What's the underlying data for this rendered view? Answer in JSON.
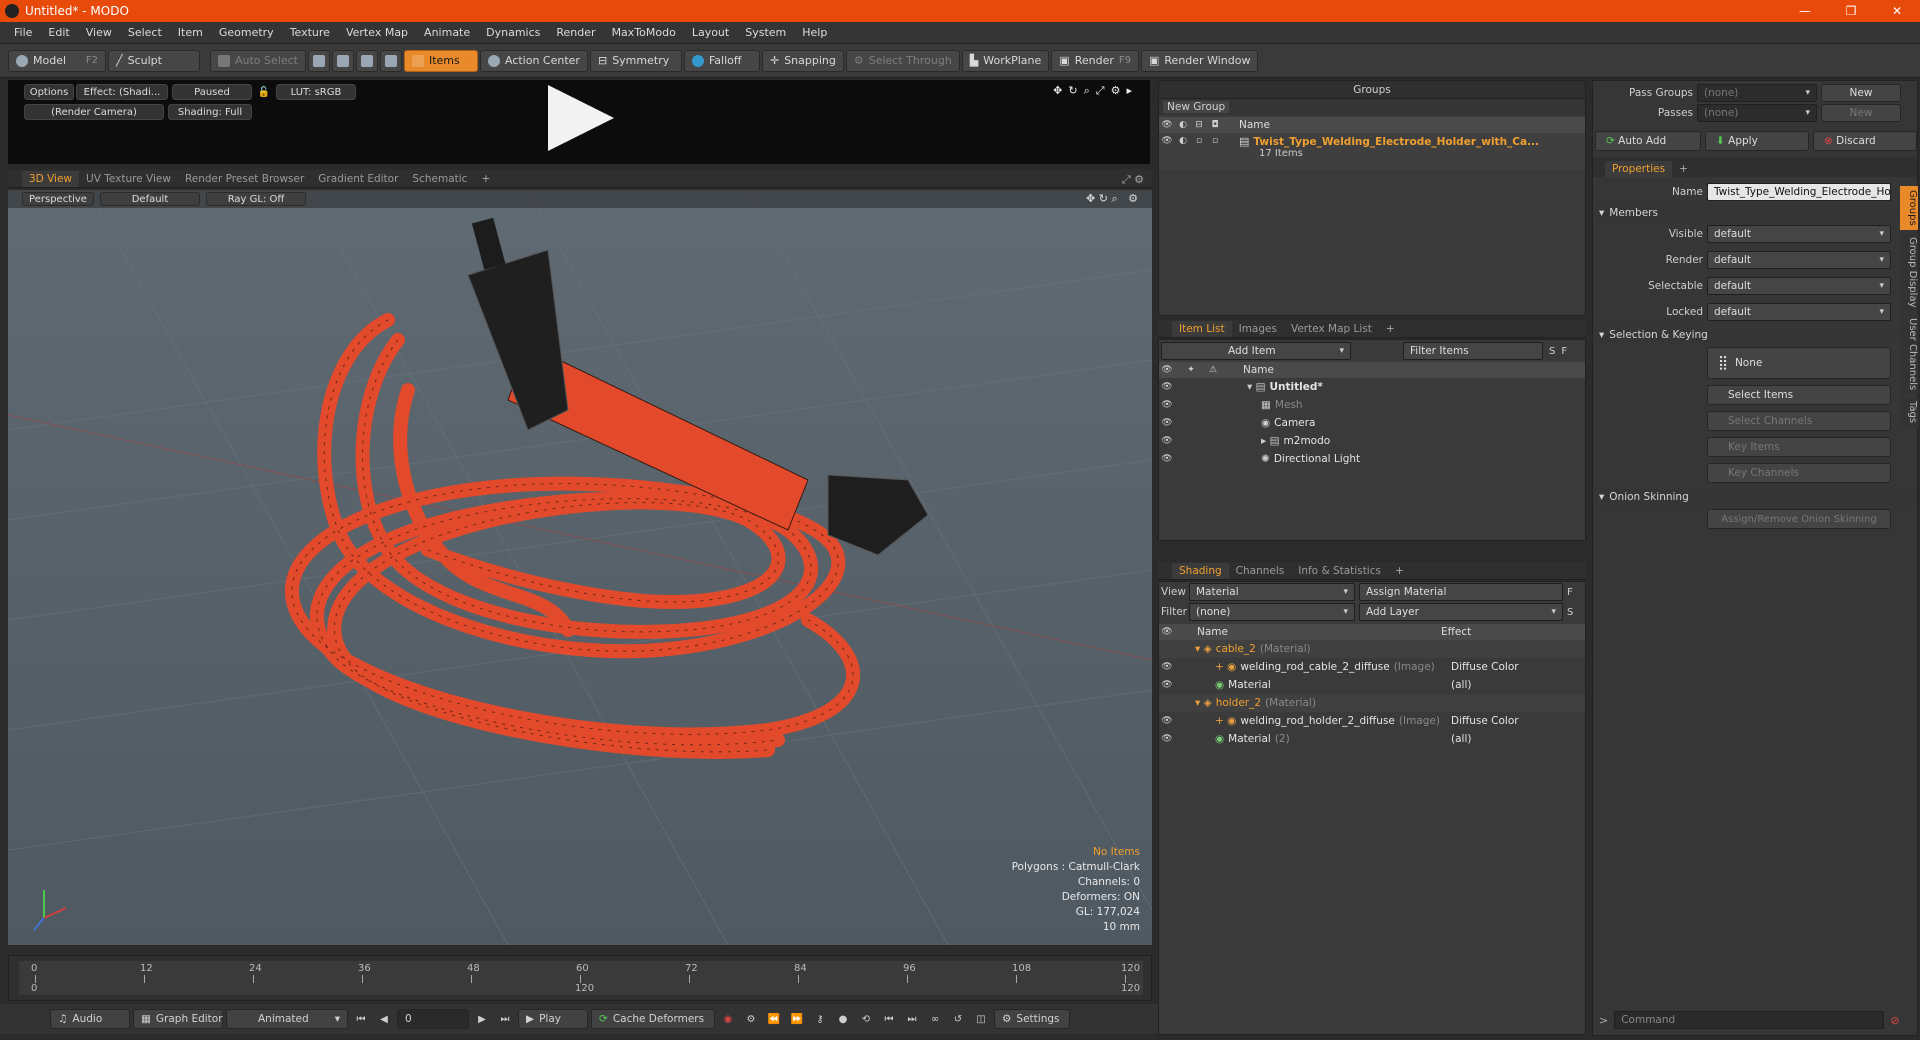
{
  "window": {
    "title": "Untitled* - MODO",
    "min": "—",
    "max": "❐",
    "close": "✕"
  },
  "menu": [
    "File",
    "Edit",
    "View",
    "Select",
    "Item",
    "Geometry",
    "Texture",
    "Vertex Map",
    "Animate",
    "Dynamics",
    "Render",
    "MaxToModo",
    "Layout",
    "System",
    "Help"
  ],
  "toolbar": {
    "model": "Model",
    "model_key": "F2",
    "sculpt": "Sculpt",
    "auto_select": "Auto Select",
    "items": "Items",
    "action_center": "Action Center",
    "symmetry": "Symmetry",
    "falloff": "Falloff",
    "snapping": "Snapping",
    "select_through": "Select Through",
    "workplane": "WorkPlane",
    "render": "Render",
    "render_key": "F9",
    "render_window": "Render Window"
  },
  "preview": {
    "options": "Options",
    "effect": "Effect: (Shadi...",
    "paused": "Paused",
    "lut": "LUT: sRGB",
    "camera": "(Render Camera)",
    "shading": "Shading: Full"
  },
  "view_tabs": [
    "3D View",
    "UV Texture View",
    "Render Preset Browser",
    "Gradient Editor",
    "Schematic",
    "+"
  ],
  "viewport": {
    "perspective": "Perspective",
    "default": "Default",
    "raygl": "Ray GL: Off",
    "stats": {
      "no_items": "No Items",
      "polygons": "Polygons : Catmull-Clark",
      "channels": "Channels: 0",
      "deformers": "Deformers: ON",
      "gl": "GL: 177,024",
      "scale": "10 mm"
    }
  },
  "timeline": {
    "ticks": [
      "0",
      "12",
      "24",
      "36",
      "48",
      "60",
      "72",
      "84",
      "96",
      "108",
      "120"
    ],
    "bottom_ticks": [
      "0",
      "120",
      "120"
    ]
  },
  "bottombar": {
    "audio": "Audio",
    "graph_editor": "Graph Editor",
    "animated": "Animated",
    "frame": "0",
    "play": "Play",
    "cache_deformers": "Cache Deformers",
    "settings": "Settings"
  },
  "groups": {
    "title": "Groups",
    "new_group": "New Group",
    "col_name": "Name",
    "item_name": "Twist_Type_Welding_Electrode_Holder_with_Ca...",
    "item_count": "17 Items"
  },
  "itemlist": {
    "tabs": [
      "Item List",
      "Images",
      "Vertex Map List",
      "+"
    ],
    "add_item": "Add Item",
    "filter_items": "Filter Items",
    "col_name": "Name",
    "items": [
      {
        "name": "Untitled*",
        "indent": 0,
        "kind": "scene"
      },
      {
        "name": "Mesh",
        "indent": 1,
        "kind": "mesh"
      },
      {
        "name": "Camera",
        "indent": 1,
        "kind": "camera"
      },
      {
        "name": "m2modo",
        "indent": 1,
        "kind": "group"
      },
      {
        "name": "Directional Light",
        "indent": 1,
        "kind": "light"
      }
    ]
  },
  "shading": {
    "tabs": [
      "Shading",
      "Channels",
      "Info & Statistics",
      "+"
    ],
    "view_label": "View",
    "view_value": "Material",
    "assign_material": "Assign Material",
    "filter_label": "Filter",
    "filter_value": "(none)",
    "add_layer": "Add Layer",
    "col_name": "Name",
    "col_effect": "Effect",
    "rows": [
      {
        "name": "cable_2",
        "tag": "(Material)",
        "effect": "",
        "level": 0
      },
      {
        "name": "welding_rod_cable_2_diffuse",
        "tag": "(Image)",
        "effect": "Diffuse Color",
        "level": 1
      },
      {
        "name": "Material",
        "tag": "",
        "effect": "(all)",
        "level": 1
      },
      {
        "name": "holder_2",
        "tag": "(Material)",
        "effect": "",
        "level": 0
      },
      {
        "name": "welding_rod_holder_2_diffuse",
        "tag": "(Image)",
        "effect": "Diffuse Color",
        "level": 1
      },
      {
        "name": "Material",
        "tag": "(2)",
        "effect": "(all)",
        "level": 1
      }
    ]
  },
  "props": {
    "pass_groups": "Pass Groups",
    "pass_groups_val": "(none)",
    "new": "New",
    "passes": "Passes",
    "passes_val": "(none)",
    "new2": "New",
    "auto_add": "Auto Add",
    "apply": "Apply",
    "discard": "Discard",
    "tab": "Properties",
    "tab_plus": "+",
    "name_label": "Name",
    "name_value": "Twist_Type_Welding_Electrode_Holder",
    "members": "Members",
    "visible": "Visible",
    "render": "Render",
    "selectable": "Selectable",
    "locked": "Locked",
    "dflt": "default",
    "sel_keying": "Selection & Keying",
    "none": "None",
    "select_items": "Select Items",
    "select_channels": "Select Channels",
    "key_items": "Key Items",
    "key_channels": "Key Channels",
    "onion": "Onion Skinning",
    "assign_onion": "Assign/Remove Onion Skinning",
    "vtabs": [
      "Groups",
      "Group Display",
      "User Channels",
      "Tags"
    ],
    "command": "Command"
  },
  "colors": {
    "accent": "#e8892a",
    "title": "#e84a0c",
    "cable": "#e24a2b"
  }
}
